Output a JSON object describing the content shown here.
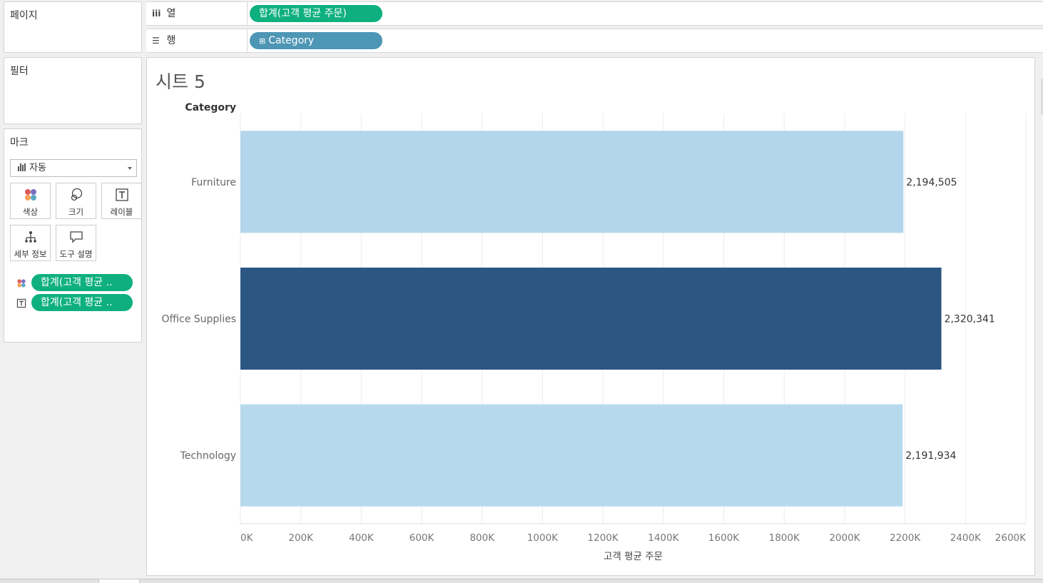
{
  "panels": {
    "pages_title": "페이지",
    "filters_title": "필터",
    "marks_title": "마크"
  },
  "marks": {
    "type_selected": "자동",
    "cards": [
      {
        "label": "색상",
        "icon": "color-icon"
      },
      {
        "label": "크기",
        "icon": "size-icon"
      },
      {
        "label": "레이블",
        "icon": "label-icon"
      },
      {
        "label": "세부 정보",
        "icon": "detail-icon"
      },
      {
        "label": "도구 설명",
        "icon": "tooltip-icon"
      }
    ],
    "fields": [
      {
        "icon": "color-icon",
        "label": "합계(고객 평균 .."
      },
      {
        "icon": "label-icon",
        "label": "합계(고객 평균 .."
      }
    ]
  },
  "shelves": {
    "columns_label": "열",
    "columns_icon": "columns-icon",
    "columns_pill": "합계(고객 평균 주문)",
    "rows_label": "행",
    "rows_icon": "rows-icon",
    "rows_pill": "Category",
    "rows_pill_prefix": "⊞"
  },
  "view": {
    "title": "시트 5"
  },
  "colors": {
    "bar_low": "#b6d9ee",
    "bar_high": "#2c5782",
    "measure_pill": "#0fb07f",
    "dimension_pill": "#4e96b5"
  },
  "chart_data": {
    "type": "bar",
    "orientation": "horizontal",
    "row_header": "Category",
    "categories": [
      "Furniture",
      "Office Supplies",
      "Technology"
    ],
    "values": [
      2194505,
      2320341,
      2191934
    ],
    "value_labels": [
      "2,194,505",
      "2,320,341",
      "2,191,934"
    ],
    "xlabel": "고객 평균 주문",
    "xlim": [
      0,
      2600000
    ],
    "xticks": [
      0,
      200000,
      400000,
      600000,
      800000,
      1000000,
      1200000,
      1400000,
      1600000,
      1800000,
      2000000,
      2200000,
      2400000,
      2600000
    ],
    "xtick_labels": [
      "0K",
      "200K",
      "400K",
      "600K",
      "800K",
      "1000K",
      "1200K",
      "1400K",
      "1600K",
      "1800K",
      "2000K",
      "2200K",
      "2400K",
      "2600K"
    ],
    "grid": true,
    "color_encoding": "sequential by value"
  }
}
